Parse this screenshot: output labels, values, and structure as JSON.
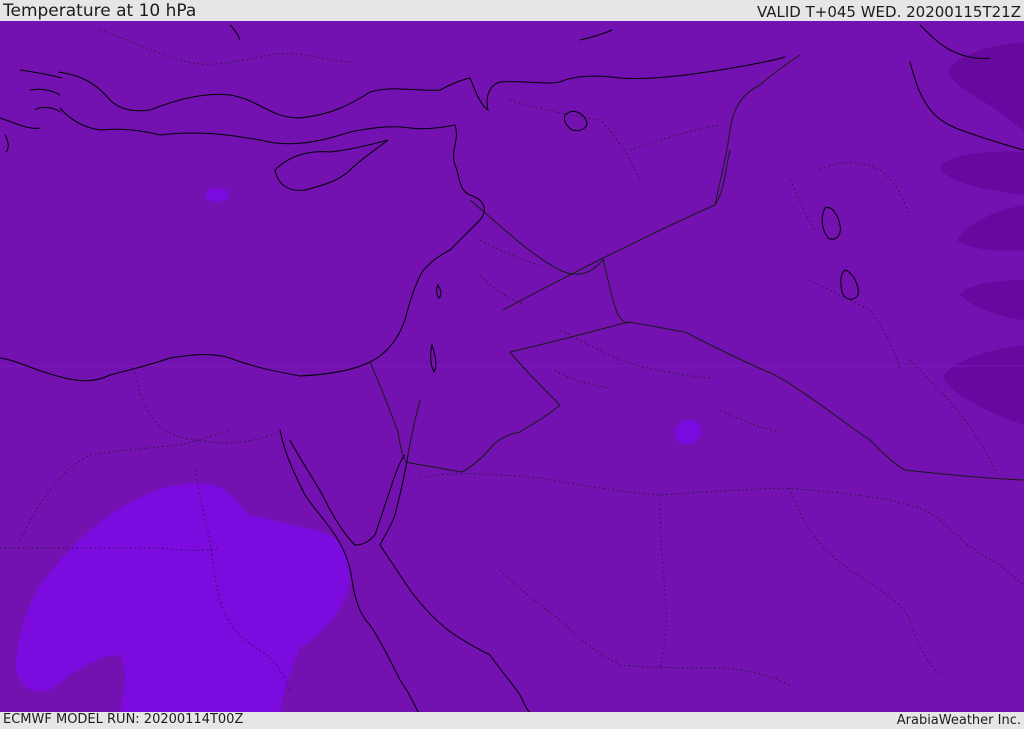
{
  "header": {
    "title": "Temperature at 10 hPa",
    "valid": "VALID T+045 WED. 20200115T21Z"
  },
  "footer": {
    "model_run": "ECMWF MODEL RUN: 20200114T00Z",
    "credit": "ArabiaWeather Inc."
  },
  "map": {
    "colors": {
      "background": "#7311b1",
      "warm_patch": "#7c0be0",
      "cold_band": "#67089e",
      "coastline": "#000000",
      "border": "#1a1a1a"
    }
  }
}
